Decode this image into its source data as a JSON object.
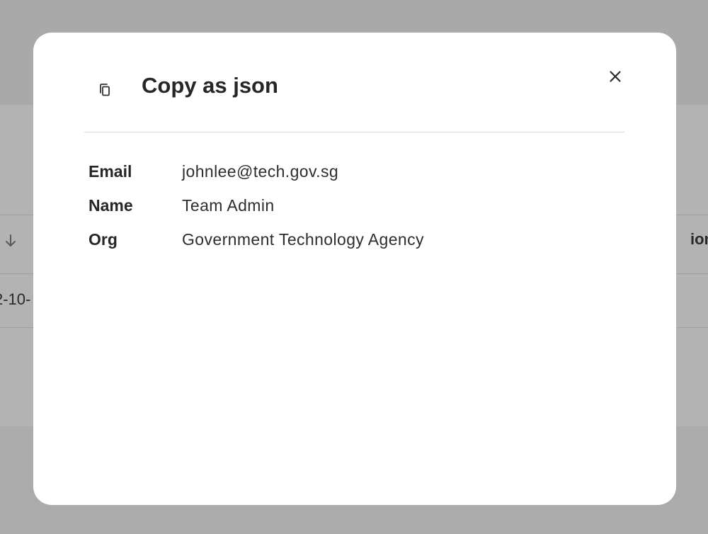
{
  "background": {
    "table_header_partial": "ion",
    "table_cell_partial": "2-10-",
    "sort_icon": "arrow-down-icon"
  },
  "modal": {
    "title": "Copy as json",
    "title_icon": "copy-icon",
    "close_icon": "close-icon",
    "details": [
      {
        "label": "Email",
        "value": "johnlee@tech.gov.sg"
      },
      {
        "label": "Name",
        "value": "Team Admin"
      },
      {
        "label": "Org",
        "value": "Government Technology Agency"
      }
    ]
  }
}
